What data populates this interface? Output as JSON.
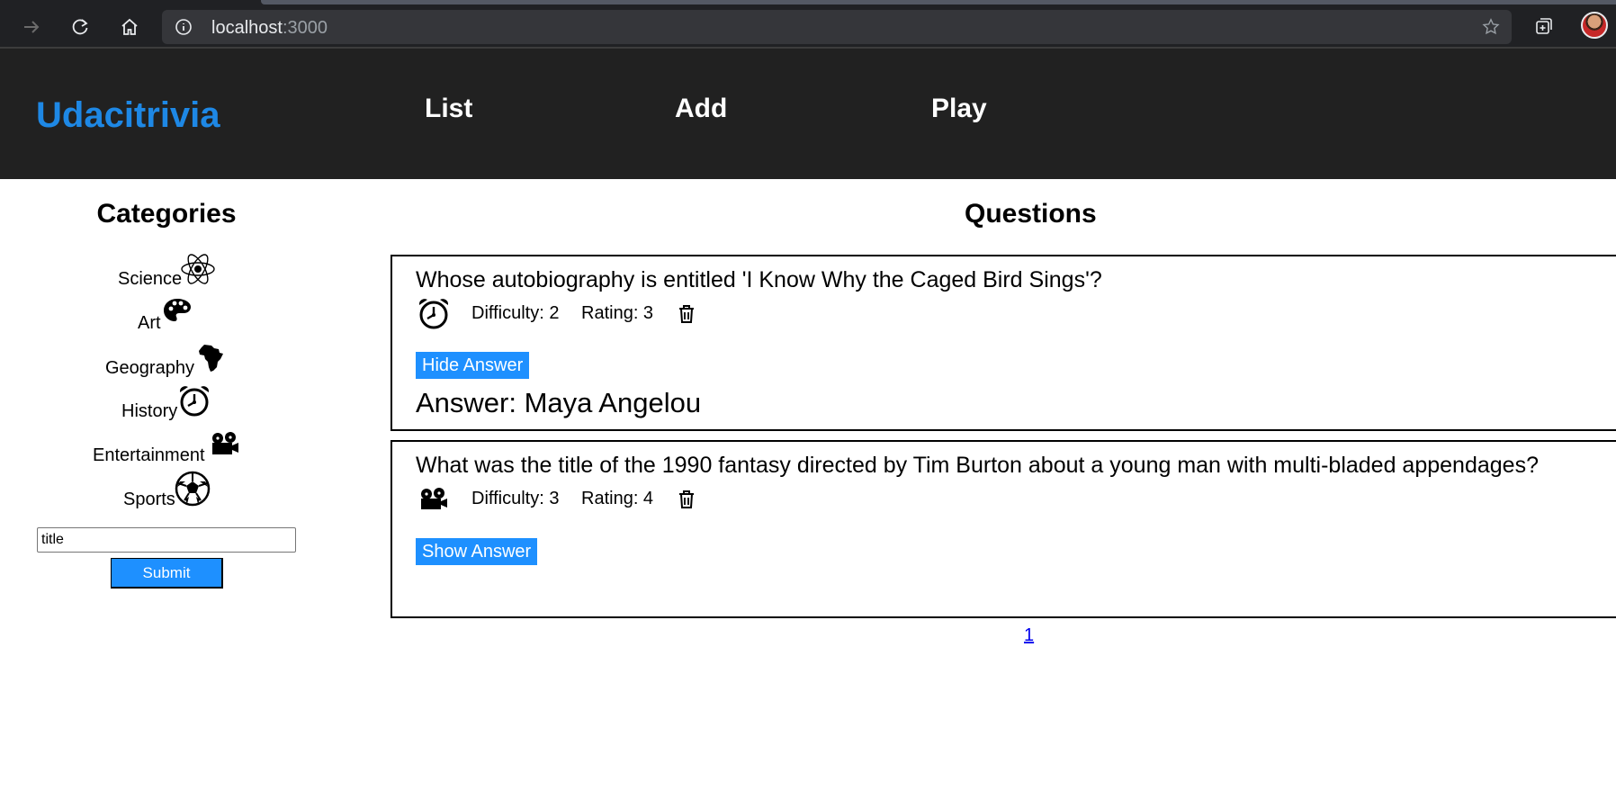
{
  "browser": {
    "url_host": "localhost",
    "url_port": ":3000",
    "icons": [
      "forward-icon",
      "reload-icon",
      "home-icon",
      "info-icon",
      "favorite-star-icon",
      "collections-icon",
      "profile-avatar"
    ]
  },
  "header": {
    "brand": "Udacitrivia",
    "nav": [
      "List",
      "Add",
      "Play"
    ],
    "brand_color": "#1e88e5",
    "background": "#212121"
  },
  "categories": {
    "title": "Categories",
    "items": [
      {
        "label": "Science",
        "icon": "atom-icon"
      },
      {
        "label": "Art",
        "icon": "palette-icon"
      },
      {
        "label": "Geography",
        "icon": "africa-icon"
      },
      {
        "label": "History",
        "icon": "alarm-clock-icon"
      },
      {
        "label": "Entertainment",
        "icon": "film-projector-icon"
      },
      {
        "label": "Sports",
        "icon": "soccer-ball-icon"
      }
    ],
    "search": {
      "value": "title",
      "placeholder": ""
    },
    "submit_label": "Submit"
  },
  "questions": {
    "title": "Questions",
    "items": [
      {
        "question": "Whose autobiography is entitled 'I Know Why the Caged Bird Sings'?",
        "category_icon": "alarm-clock-icon",
        "difficulty": "Difficulty: 2",
        "rating": "Rating: 3",
        "toggle_label": "Hide Answer",
        "answer": "Answer: Maya Angelou"
      },
      {
        "question": "What was the title of the 1990 fantasy directed by Tim Burton about a young man with multi-bladed appendages?",
        "category_icon": "film-projector-icon",
        "difficulty": "Difficulty: 3",
        "rating": "Rating: 4",
        "toggle_label": "Show Answer",
        "answer": ""
      }
    ],
    "pages": [
      "1"
    ],
    "button_color": "#1e90ff"
  }
}
